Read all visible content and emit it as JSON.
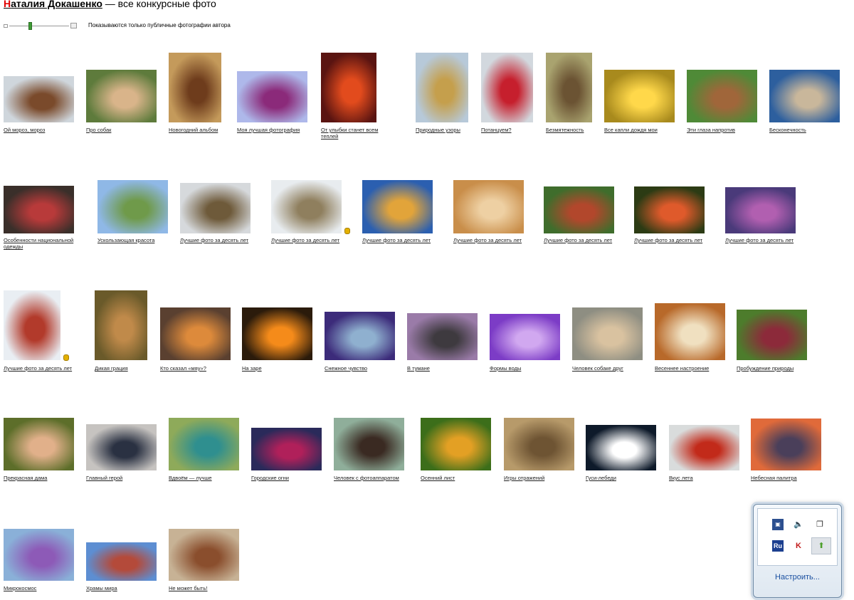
{
  "header": {
    "author_first": "Н",
    "author_rest": "аталия Докашенко",
    "title_rest": " — все конкурсные фото"
  },
  "toolbar": {
    "public_note": "Показываются только публичные фотографии автора"
  },
  "photos": [
    {
      "caption": "Ой мороз, мороз",
      "colors": [
        "#cfd6dc",
        "#7a4a2b"
      ]
    },
    {
      "caption": "Про собак",
      "colors": [
        "#5e7b3c",
        "#d9b48a"
      ]
    },
    {
      "caption": "Новогодний альбом",
      "colors": [
        "#c49a5b",
        "#6e3c1c"
      ]
    },
    {
      "caption": "Моя лучшая фотография",
      "colors": [
        "#aeb8ea",
        "#8b2a7a"
      ]
    },
    {
      "caption": "От улыбки станет всем теплей",
      "colors": [
        "#5a1411",
        "#e24b1d"
      ]
    },
    {
      "caption": "Природные узоры",
      "colors": [
        "#b7c9d9",
        "#c59f4c"
      ]
    },
    {
      "caption": "Потанцуем?",
      "colors": [
        "#d2d8de",
        "#c61f2d"
      ]
    },
    {
      "caption": "Безмятежность",
      "colors": [
        "#a9a36f",
        "#6b5333"
      ]
    },
    {
      "caption": "Все капли дождя мои",
      "colors": [
        "#a88a1d",
        "#ffd84a"
      ]
    },
    {
      "caption": "Эти глаза напротив",
      "colors": [
        "#4f8a37",
        "#a0663a"
      ]
    },
    {
      "caption": "Бесконечность",
      "colors": [
        "#2d5f9e",
        "#c9b79b"
      ]
    },
    {
      "caption": "Особенности национальной одежды",
      "colors": [
        "#3a2f2a",
        "#b83a3a"
      ]
    },
    {
      "caption": "Ускользающая красота",
      "colors": [
        "#8fb8e6",
        "#6f9a4a"
      ]
    },
    {
      "caption": "Лучшие фото за десять лет",
      "colors": [
        "#d6d9dc",
        "#6e5a3a"
      ]
    },
    {
      "caption": "Лучшие фото за десять лет",
      "colors": [
        "#e8ecef",
        "#8f7f5e"
      ],
      "medal": true
    },
    {
      "caption": "Лучшие фото за десять лет",
      "colors": [
        "#2b5fb0",
        "#e2a43a"
      ]
    },
    {
      "caption": "Лучшие фото за десять лет",
      "colors": [
        "#c98e4a",
        "#eed0a3"
      ]
    },
    {
      "caption": "Лучшие фото за десять лет",
      "colors": [
        "#3f6d2c",
        "#b2472c"
      ]
    },
    {
      "caption": "Лучшие фото за десять лет",
      "colors": [
        "#2c3b14",
        "#df5a2b"
      ]
    },
    {
      "caption": "Лучшие фото за десять лет",
      "colors": [
        "#4a3a7a",
        "#b15fb0"
      ]
    },
    {
      "caption": "Лучшие фото за десять лет",
      "colors": [
        "#e9eef3",
        "#b23a2b"
      ],
      "medal": true
    },
    {
      "caption": "Дикая грация",
      "colors": [
        "#6a5a2a",
        "#c08a4a"
      ]
    },
    {
      "caption": "Кто сказал «мяу»?",
      "colors": [
        "#5a4030",
        "#dd8a3b"
      ]
    },
    {
      "caption": "На заре",
      "colors": [
        "#2b1b0b",
        "#f58b1a"
      ]
    },
    {
      "caption": "Снежное чувство",
      "colors": [
        "#3c2b7a",
        "#8fb0cf"
      ]
    },
    {
      "caption": "В тумане",
      "colors": [
        "#9a7ba8",
        "#3e3a3f"
      ]
    },
    {
      "caption": "Формы воды",
      "colors": [
        "#7c3cc6",
        "#d1a8f0"
      ]
    },
    {
      "caption": "Человек собаке друг",
      "colors": [
        "#8e8e82",
        "#d9c2a0"
      ]
    },
    {
      "caption": "Весеннее настроение",
      "colors": [
        "#b8692a",
        "#f0e0c0"
      ]
    },
    {
      "caption": "Пробуждение природы",
      "colors": [
        "#4d7c2c",
        "#8c2a3a"
      ]
    },
    {
      "caption": "Прекрасная дама",
      "colors": [
        "#5d6e2a",
        "#e1b08a"
      ]
    },
    {
      "caption": "Главный герой",
      "colors": [
        "#c6c3c0",
        "#2a3142"
      ]
    },
    {
      "caption": "Вдвоём — лучше",
      "colors": [
        "#8eaa5a",
        "#2f8f8f"
      ]
    },
    {
      "caption": "Городские огни",
      "colors": [
        "#2a2a5a",
        "#b0205a"
      ]
    },
    {
      "caption": "Человек с фотоаппаратом",
      "colors": [
        "#8fae9a",
        "#3a2a22"
      ]
    },
    {
      "caption": "Осенний лист",
      "colors": [
        "#3c6e1a",
        "#e3a024"
      ]
    },
    {
      "caption": "Игры отражений",
      "colors": [
        "#b79a6a",
        "#6e5433"
      ]
    },
    {
      "caption": "Гуси-лебеди",
      "colors": [
        "#0e1a2a",
        "#ffffff"
      ]
    },
    {
      "caption": "Вкус лета",
      "colors": [
        "#d9dcdc",
        "#c22a1a"
      ]
    },
    {
      "caption": "Небесная палитра",
      "colors": [
        "#e06a3a",
        "#4a3f5a"
      ]
    },
    {
      "caption": "Микрокосмос",
      "colors": [
        "#8ab0d8",
        "#8d5ab7"
      ]
    },
    {
      "caption": "Храмы мира",
      "colors": [
        "#5d8ed2",
        "#b44a3a"
      ]
    },
    {
      "caption": "Не может быть!",
      "colors": [
        "#c7b295",
        "#8a4e2d"
      ]
    }
  ],
  "tray": {
    "icons": [
      "network-icon",
      "speaker-icon",
      "display-icon",
      "language-icon",
      "antivirus-icon",
      "update-icon"
    ],
    "language_label": "Ru",
    "customize_label": "Настроить..."
  }
}
